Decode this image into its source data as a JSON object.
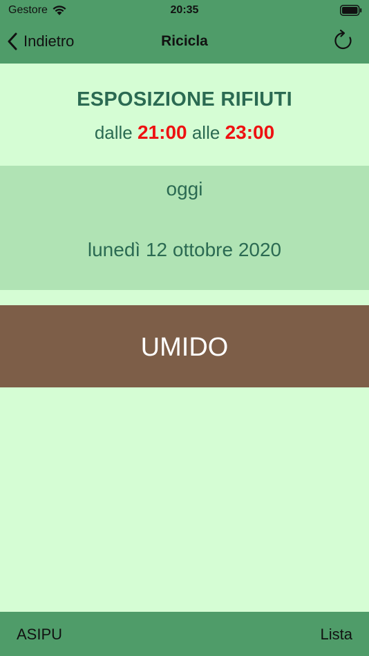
{
  "status_bar": {
    "carrier": "Gestore",
    "time": "20:35"
  },
  "nav": {
    "back_label": "Indietro",
    "title": "Ricicla"
  },
  "exposure": {
    "title": "ESPOSIZIONE RIFIUTI",
    "from_word": "dalle",
    "from_time": "21:00",
    "to_word": "alle",
    "to_time": "23:00"
  },
  "date": {
    "relative": "oggi",
    "full": "lunedì 12 ottobre 2020"
  },
  "waste": {
    "type": "UMIDO",
    "color": "#7d5e48"
  },
  "toolbar": {
    "left_label": "ASIPU",
    "right_label": "Lista"
  },
  "colors": {
    "bar_green": "#4f9c69",
    "background": "#d5fdd4",
    "date_band": "#b0e3b4",
    "text_green": "#2b6a52",
    "time_red": "#ee1111"
  }
}
